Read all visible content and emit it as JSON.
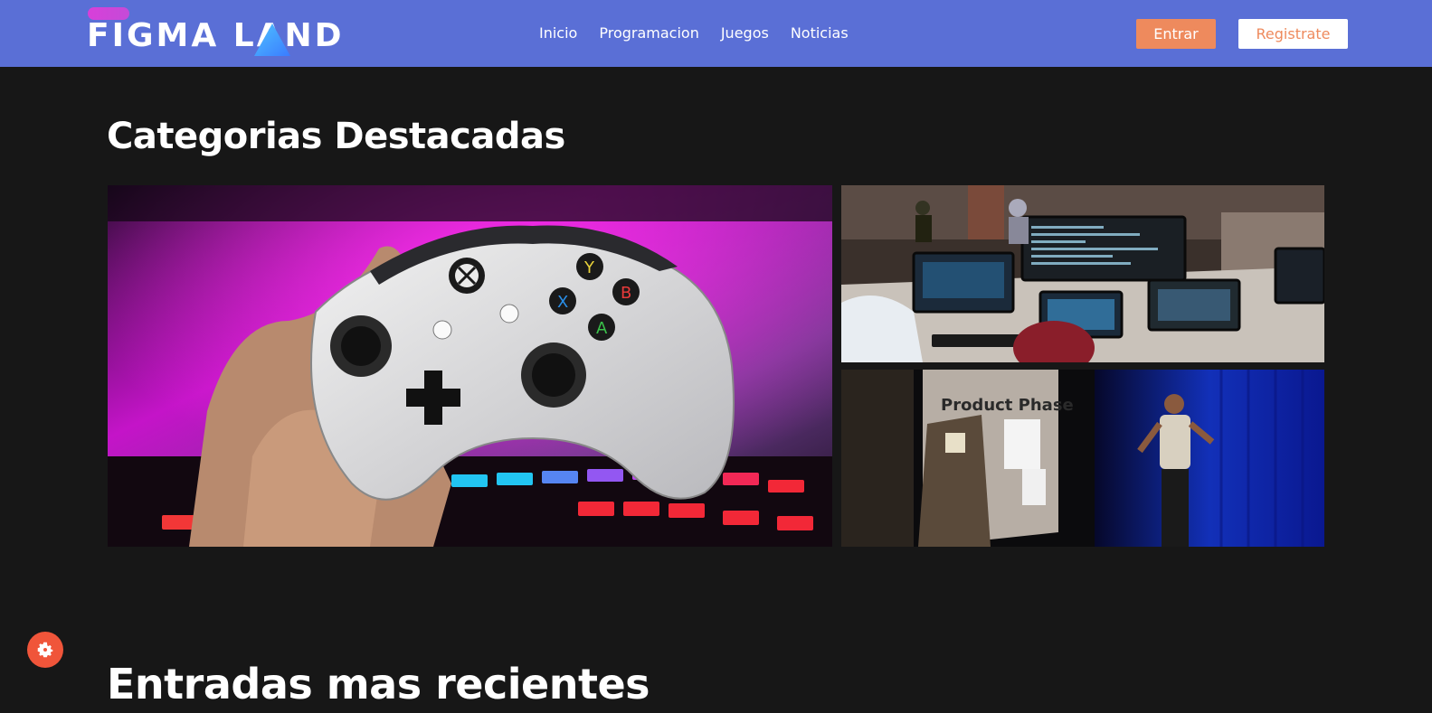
{
  "header": {
    "logo_text": "FIGMA LAND",
    "nav": [
      "Inicio",
      "Programacion",
      "Juegos",
      "Noticias"
    ],
    "login_label": "Entrar",
    "register_label": "Registrate"
  },
  "featured": {
    "title": "Categorias Destacadas",
    "cards": [
      {
        "name": "gaming-controller-image"
      },
      {
        "name": "coding-workspace-image"
      },
      {
        "name": "conference-talk-image"
      }
    ]
  },
  "recent": {
    "title": "Entradas mas recientes"
  },
  "colors": {
    "header_bg": "#5a6fd6",
    "page_bg": "#171717",
    "accent": "#ee8a5d",
    "fab": "#f0553a"
  },
  "icons": {
    "settings": "gear-icon"
  }
}
